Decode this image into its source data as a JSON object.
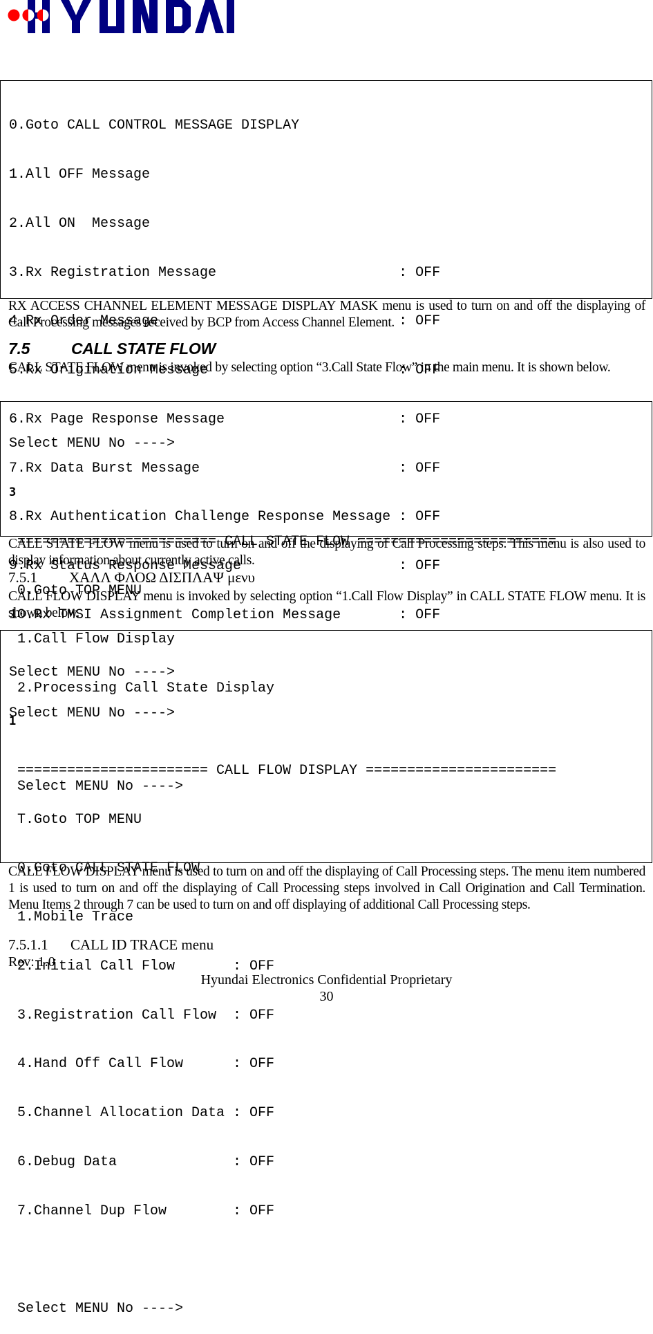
{
  "header": {
    "logo_text": "HYUNDAI",
    "logo_colors": {
      "text": "#000080",
      "dots": "#ff0000"
    }
  },
  "box1": {
    "lines": [
      "0.Goto CALL CONTROL MESSAGE DISPLAY",
      "1.All OFF Message",
      "2.All ON  Message",
      "3.Rx Registration Message                      : OFF",
      "4.Rx Order Message                             : OFF",
      "5.Rx Origination Message                       : OFF",
      "6.Rx Page Response Message                     : OFF",
      "7.Rx Data Burst Message                        : OFF",
      "8.Rx Authentication Challenge Response Message : OFF",
      "9.Rx Status Response Message                   : OFF",
      "10.Rx TMSI Assignment Completion Message       : OFF",
      "",
      "Select MENU No ---->"
    ]
  },
  "para1": "RX ACCESS CHANNEL ELEMENT MESSAGE DISPLAY MASK menu is used to turn on and off the displaying of Call Processing messages received by BCP from Access Channel Element.",
  "section_7_5": {
    "number": "7.5",
    "title": "CALL STATE FLOW"
  },
  "para2": "CALL STATE FLOW menu is invoked by selecting option “3.Call State Flow” in the main menu. It is shown below.",
  "box2": {
    "prompt": "Select MENU No ---->",
    "input": "3",
    "lines": [
      "======================== CALL STATE FLOW ========================",
      "0.Goto TOP MENU",
      "1.Call Flow Display",
      "2.Processing Call State Display",
      "",
      "Select MENU No ---->"
    ]
  },
  "para3": "CALL STATE FLOW menu is used to turn on and off the displaying of Call Processing steps. This menu is also used to display information about currently active calls.",
  "section_7_5_1": {
    "number": "7.5.1",
    "title": "ΧΑΛΛ ΦΛΟΩ ΔΙΣΠΛΑΨ μενυ"
  },
  "para4": "CALL FLOW DISPLAY menu is invoked by selecting option “1.Call Flow Display” in CALL STATE FLOW menu. It is shown below.",
  "box3": {
    "prompt": "Select MENU No ---->",
    "input": "1",
    "lines": [
      "======================= CALL FLOW DISPLAY =======================",
      "T.Goto TOP MENU",
      "0.Goto CALL STATE FLOW",
      "1.Mobile Trace",
      "2.Initial Call Flow       : OFF",
      "3.Registration Call Flow  : OFF",
      "4.Hand Off Call Flow      : OFF",
      "5.Channel Allocation Data : OFF",
      "6.Debug Data              : OFF",
      "7.Channel Dup Flow        : OFF",
      "",
      "Select MENU No ---->"
    ]
  },
  "para5": "CALL FLOW DISPLAY menu is used to turn on and off the displaying of Call Processing steps. The menu item numbered 1 is used to turn on and off the displaying of Call Processing steps involved in Call Origination and Call Termination. Menu Items 2 through 7 can be used to turn on and off displaying of additional Call Processing steps.",
  "section_7_5_1_1": {
    "number": "7.5.1.1",
    "title": "CALL ID TRACE menu"
  },
  "footer": {
    "rev": "Rev: 1.0",
    "confidential": "Hyundai Electronics Confidential Proprietary",
    "page_number": "30"
  }
}
